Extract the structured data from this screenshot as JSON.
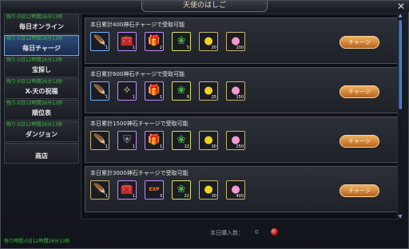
{
  "window": {
    "title": "天使のはしご"
  },
  "sidebar": {
    "items": [
      {
        "timer": "残り:0日12時間26分13秒",
        "label": "毎日オンライン",
        "active": false
      },
      {
        "timer": "残り:0日12時間26分13秒",
        "label": "毎日チャージ",
        "active": true
      },
      {
        "timer": "残り:0日12時間26分13秒",
        "label": "宝探し",
        "active": false
      },
      {
        "timer": "残り:0日12時間26分13秒",
        "label": "X-天の祝福",
        "active": false
      },
      {
        "timer": "残り:0日12時間26分13秒",
        "label": "順位表",
        "active": false
      },
      {
        "timer": "残り:0日12時間26分13秒",
        "label": "ダンジョン",
        "active": false
      },
      {
        "timer": "",
        "label": "商店",
        "active": false
      }
    ],
    "bottom_timer": "残り時間:0日12時間26分13秒"
  },
  "tiers": [
    {
      "title": "本日累計400神石チャージで受取可能",
      "button": "チャージ",
      "rewards": [
        {
          "icon": "feather-icon",
          "glyph": "🪶",
          "qty": "1",
          "frame": "blue"
        },
        {
          "icon": "chest-icon",
          "glyph": "🧰",
          "qty": "1",
          "frame": "purple"
        },
        {
          "icon": "giftbox-icon",
          "glyph": "🎁",
          "qty": "2",
          "frame": "purple"
        },
        {
          "icon": "wreath-icon",
          "glyph": "❀",
          "qty": "5",
          "frame": "green"
        },
        {
          "icon": "gold-coin-icon",
          "glyph": "●",
          "qty": "20",
          "frame": "gold"
        },
        {
          "icon": "pink-coin-icon",
          "glyph": "●",
          "qty": "100",
          "frame": "gold"
        }
      ]
    },
    {
      "title": "本日累計600神石チャージで受取可能",
      "button": "チャージ",
      "rewards": [
        {
          "icon": "feather-icon",
          "glyph": "🪶",
          "qty": "1",
          "frame": "blue"
        },
        {
          "icon": "wings-icon",
          "glyph": "✧",
          "qty": "1",
          "frame": "purple"
        },
        {
          "icon": "giftbox-icon",
          "glyph": "🎁",
          "qty": "1",
          "frame": "purple"
        },
        {
          "icon": "wreath-icon",
          "glyph": "❀",
          "qty": "8",
          "frame": "green"
        },
        {
          "icon": "gold-coin-icon",
          "glyph": "●",
          "qty": "25",
          "frame": "gold"
        },
        {
          "icon": "pink-coin-icon",
          "glyph": "●",
          "qty": "150",
          "frame": "gold"
        }
      ]
    },
    {
      "title": "本日累計1500神石チャージで受取可能",
      "button": "チャージ",
      "rewards": [
        {
          "icon": "feather-icon",
          "glyph": "🪶",
          "qty": "1",
          "frame": "gold"
        },
        {
          "icon": "armor-icon",
          "glyph": "⛨",
          "qty": "1",
          "frame": "purple"
        },
        {
          "icon": "giftbox-icon",
          "glyph": "🎁",
          "qty": "1",
          "frame": "purple"
        },
        {
          "icon": "wreath-icon",
          "glyph": "❀",
          "qty": "12",
          "frame": "green"
        },
        {
          "icon": "gold-coin-icon",
          "glyph": "●",
          "qty": "30",
          "frame": "gold"
        },
        {
          "icon": "pink-coin-icon",
          "glyph": "●",
          "qty": "250",
          "frame": "gold"
        }
      ]
    },
    {
      "title": "本日累計3000神石チャージで受取可能",
      "button": "チャージ",
      "rewards": [
        {
          "icon": "feather-icon",
          "glyph": "🪶",
          "qty": "1",
          "frame": "gold"
        },
        {
          "icon": "chest-icon",
          "glyph": "🧰",
          "qty": "1",
          "frame": "purple"
        },
        {
          "icon": "exp-badge-icon",
          "glyph": "EXP",
          "qty": "3",
          "frame": "purple"
        },
        {
          "icon": "wreath-icon",
          "glyph": "❀",
          "qty": "22",
          "frame": "green"
        },
        {
          "icon": "gold-coin-icon",
          "glyph": "●",
          "qty": "30",
          "frame": "gold"
        },
        {
          "icon": "pink-coin-icon",
          "glyph": "●",
          "qty": "400",
          "frame": "gold"
        }
      ]
    }
  ],
  "footer": {
    "purchase_label": "本日購入数：",
    "purchase_count": "0"
  },
  "colors": {
    "accent": "#7fa6e0",
    "timer_green": "#3fbf3f",
    "button_orange": "#e08a3a"
  }
}
